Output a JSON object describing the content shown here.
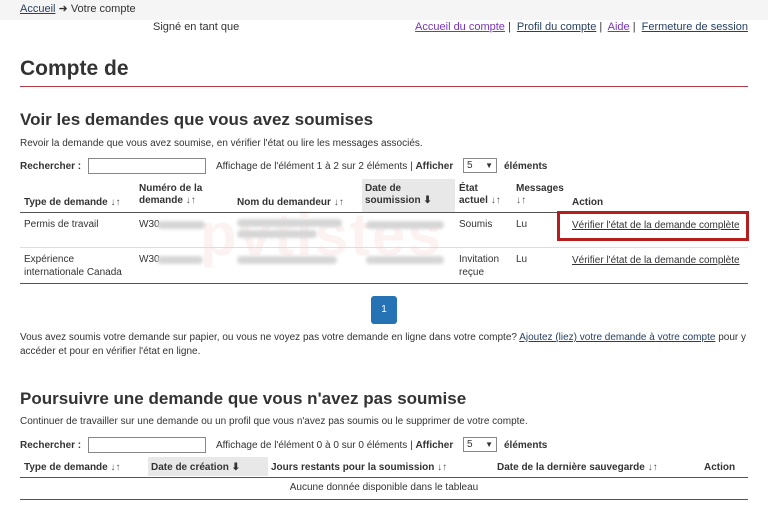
{
  "breadcrumb": {
    "home": "Accueil",
    "arrow": "➜",
    "current": "Votre compte"
  },
  "signed_in": "Signé en tant que",
  "account_links": [
    {
      "label": "Accueil du compte"
    },
    {
      "label": "Profil du compte"
    },
    {
      "label": "Aide"
    },
    {
      "label": "Fermeture de session"
    }
  ],
  "link_separator": "|",
  "page_title": "Compte de",
  "submitted": {
    "heading": "Voir les demandes que vous avez soumises",
    "intro": "Revoir la demande que vous avez soumise, en vérifier l'état ou lire les messages associés.",
    "search_label": "Rechercher :",
    "search_value": "",
    "info": "Affichage de l'élément 1 à 2 sur 2 éléments |",
    "show_label": "Afficher",
    "show_value": "5",
    "elements_label": "éléments",
    "columns": {
      "type": "Type de demande",
      "number_l1": "Numéro de la",
      "number_l2": "demande",
      "name": "Nom du demandeur",
      "date_l1": "Date de",
      "date_l2": "soumission",
      "status_l1": "État",
      "status_l2": "actuel",
      "messages": "Messages",
      "action": "Action"
    },
    "rows": [
      {
        "type_l1": "Permis de travail",
        "type_l2": "",
        "number": "W30",
        "status_l1": "Soumis",
        "status_l2": "",
        "messages": "Lu",
        "action": "Vérifier l'état de la demande complète"
      },
      {
        "type_l1": "Expérience",
        "type_l2": "internationale Canada",
        "number": "W30",
        "status_l1": "Invitation",
        "status_l2": "reçue",
        "messages": "Lu",
        "action": "Vérifier l'état de la demande complète"
      }
    ],
    "page": "1",
    "paper_text": "Vous avez soumis votre demande sur papier, ou vous ne voyez pas votre demande en ligne dans votre compte?",
    "paper_link": "Ajoutez (liez) votre demande à votre compte",
    "paper_text2": "pour y accéder et pour en vérifier l'état en ligne."
  },
  "unsubmitted": {
    "heading": "Poursuivre une demande que vous n'avez pas soumise",
    "intro": "Continuer de travailler sur une demande ou un profil que vous n'avez pas soumis ou le supprimer de votre compte.",
    "search_label": "Rechercher :",
    "search_value": "",
    "info": "Affichage de l'élément 0 à 0 sur 0 éléments |",
    "show_label": "Afficher",
    "show_value": "5",
    "elements_label": "éléments",
    "columns": {
      "type": "Type de demande",
      "created": "Date de création",
      "days": "Jours restants pour la soumission",
      "saved": "Date de la dernière sauvegarde",
      "action": "Action"
    },
    "empty": "Aucune donnée disponible dans le tableau"
  },
  "sort_icon": "↓↑",
  "sort_desc_icon": "🡇",
  "watermark": "pvtistes",
  "colors": {
    "accent_rule": "#af3c43",
    "link": "#284162",
    "visited": "#7834bc",
    "page_button": "#2572b4",
    "highlight": "#b41e1e"
  }
}
